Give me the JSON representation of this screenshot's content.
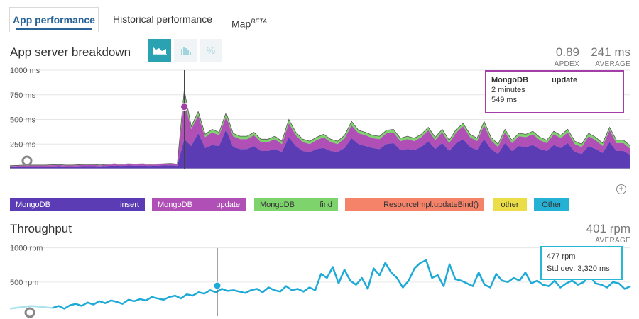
{
  "tabs": [
    {
      "label": "App performance",
      "active": true
    },
    {
      "label": "Historical performance",
      "active": false
    },
    {
      "label": "Map",
      "badge": "BETA",
      "active": false
    }
  ],
  "breakdown": {
    "title": "App server breakdown",
    "view_buttons": [
      {
        "icon": "area-chart-icon",
        "active": true
      },
      {
        "icon": "bar-chart-icon",
        "active": false
      },
      {
        "icon": "percent-icon",
        "label": "%",
        "active": false
      }
    ],
    "apdex": {
      "value": "0.89",
      "label": "APDEX"
    },
    "average": {
      "value": "241 ms",
      "label": "AVERAGE"
    },
    "y_axis_labels": [
      "1000 ms",
      "750 ms",
      "500 ms",
      "250 ms"
    ],
    "tooltip": {
      "name": "MongoDB",
      "operation": "update",
      "time_ago": "2 minutes",
      "value": "549 ms"
    },
    "legend": [
      {
        "name": "MongoDB",
        "operation": "insert",
        "color": "#5b3cb5"
      },
      {
        "name": "MongoDB",
        "operation": "update",
        "color": "#b04fb6"
      },
      {
        "name": "MongoDB",
        "operation": "find",
        "color": "#7ed36d"
      },
      {
        "name": "",
        "operation": "ResourceImpl.updateBind()",
        "color": "#f5836a"
      },
      {
        "name": "",
        "operation": "other",
        "color": "#eadd47"
      },
      {
        "name": "",
        "operation": "Other",
        "color": "#25b1d3"
      }
    ]
  },
  "throughput": {
    "title": "Throughput",
    "average": {
      "value": "401 rpm",
      "label": "AVERAGE"
    },
    "y_axis_labels": [
      "1000 rpm",
      "500 rpm"
    ],
    "tooltip": {
      "value": "477 rpm",
      "std_dev": "Std dev: 3,320 ms"
    }
  },
  "chart_data": [
    {
      "type": "area",
      "title": "App server breakdown",
      "ylim": [
        0,
        1000
      ],
      "y_unit": "ms",
      "series": [
        {
          "name": "MongoDB insert",
          "color": "#5b3cb5",
          "values": [
            15,
            18,
            20,
            22,
            22,
            20,
            22,
            25,
            22,
            22,
            24,
            26,
            25,
            23,
            28,
            30,
            28,
            32,
            30,
            30,
            28,
            30,
            32,
            34,
            30,
            300,
            230,
            360,
            210,
            240,
            230,
            400,
            220,
            200,
            200,
            230,
            180,
            180,
            200,
            170,
            320,
            230,
            180,
            170,
            200,
            210,
            180,
            170,
            210,
            310,
            250,
            230,
            210,
            200,
            250,
            260,
            190,
            200,
            190,
            220,
            280,
            200,
            260,
            180,
            260,
            300,
            220,
            190,
            300,
            200,
            150,
            260,
            180,
            230,
            220,
            240,
            200,
            180,
            240,
            210,
            260,
            170,
            150,
            230,
            200,
            160,
            270,
            180,
            180,
            140
          ]
        },
        {
          "name": "MongoDB update",
          "color": "#b04fb6",
          "values": [
            10,
            10,
            12,
            10,
            10,
            12,
            12,
            12,
            10,
            10,
            12,
            12,
            12,
            10,
            12,
            14,
            12,
            12,
            12,
            14,
            12,
            12,
            12,
            14,
            12,
            400,
            170,
            180,
            110,
            130,
            110,
            130,
            110,
            100,
            100,
            110,
            90,
            90,
            100,
            80,
            140,
            110,
            90,
            80,
            90,
            110,
            90,
            80,
            100,
            130,
            110,
            110,
            100,
            100,
            110,
            110,
            90,
            100,
            90,
            100,
            110,
            90,
            110,
            80,
            110,
            130,
            100,
            90,
            140,
            90,
            70,
            110,
            80,
            100,
            100,
            110,
            90,
            80,
            110,
            100,
            110,
            80,
            70,
            100,
            90,
            70,
            120,
            80,
            80,
            60
          ]
        },
        {
          "name": "MongoDB find",
          "color": "#7ed36d",
          "values": [
            5,
            5,
            5,
            5,
            5,
            5,
            5,
            5,
            5,
            5,
            5,
            5,
            5,
            5,
            5,
            5,
            5,
            5,
            5,
            5,
            5,
            5,
            5,
            5,
            5,
            100,
            30,
            40,
            30,
            30,
            30,
            40,
            30,
            30,
            30,
            30,
            30,
            30,
            30,
            30,
            40,
            30,
            30,
            30,
            30,
            30,
            30,
            30,
            30,
            40,
            30,
            30,
            30,
            30,
            30,
            30,
            30,
            30,
            30,
            30,
            30,
            30,
            30,
            30,
            30,
            30,
            30,
            30,
            40,
            30,
            30,
            30,
            30,
            30,
            30,
            30,
            30,
            30,
            30,
            30,
            30,
            30,
            30,
            30,
            30,
            30,
            30,
            30,
            30,
            30
          ]
        }
      ]
    },
    {
      "type": "line",
      "title": "Throughput",
      "ylim": [
        0,
        1100
      ],
      "y_unit": "rpm",
      "series": [
        {
          "name": "Throughput",
          "color": "#1eaad6",
          "values": [
            120,
            150,
            110,
            160,
            180,
            150,
            200,
            170,
            220,
            190,
            230,
            210,
            180,
            240,
            220,
            250,
            230,
            280,
            260,
            240,
            280,
            300,
            260,
            320,
            300,
            350,
            330,
            380,
            350,
            400,
            370,
            380,
            360,
            340,
            380,
            400,
            350,
            420,
            380,
            360,
            440,
            380,
            400,
            360,
            420,
            380,
            620,
            560,
            720,
            480,
            680,
            520,
            460,
            560,
            400,
            700,
            600,
            780,
            640,
            560,
            420,
            520,
            700,
            780,
            820,
            560,
            600,
            440,
            760,
            540,
            520,
            480,
            440,
            640,
            460,
            420,
            620,
            520,
            500,
            560,
            520,
            640,
            480,
            520,
            460,
            440,
            520,
            420,
            480,
            520,
            460,
            500,
            600,
            480,
            460,
            420,
            500,
            480,
            400,
            440
          ]
        }
      ]
    }
  ]
}
